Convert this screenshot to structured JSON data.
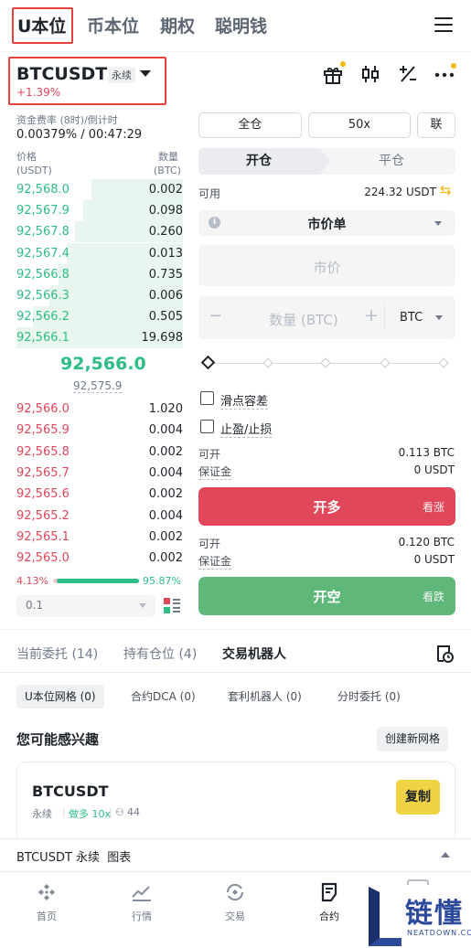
{
  "top_tabs": [
    "U本位",
    "币本位",
    "期权",
    "聪明钱"
  ],
  "symbol": "BTCUSDT",
  "perp_badge": "永续",
  "change": "+1.39%",
  "funding": {
    "label": "资金费率 (8时)/倒计时",
    "value": "0.00379% / 00:47:29"
  },
  "orderbook": {
    "price_label": "价格",
    "price_unit": "(USDT)",
    "qty_label": "数量",
    "qty_unit": "(BTC)",
    "asks": [
      {
        "p": "92,568.0",
        "q": "0.002",
        "depth": 0.55
      },
      {
        "p": "92,567.9",
        "q": "0.098",
        "depth": 0.6
      },
      {
        "p": "92,567.8",
        "q": "0.260",
        "depth": 0.65
      },
      {
        "p": "92,567.4",
        "q": "0.013",
        "depth": 0.7
      },
      {
        "p": "92,566.8",
        "q": "0.735",
        "depth": 0.75
      },
      {
        "p": "92,566.3",
        "q": "0.006",
        "depth": 0.8
      },
      {
        "p": "92,566.2",
        "q": "0.505",
        "depth": 0.9
      },
      {
        "p": "92,566.1",
        "q": "19.698",
        "depth": 1.0
      }
    ],
    "last_price": "92,566.0",
    "mark_price": "92,575.9",
    "bids": [
      {
        "p": "92,566.0",
        "q": "1.020"
      },
      {
        "p": "92,565.9",
        "q": "0.004"
      },
      {
        "p": "92,565.8",
        "q": "0.002"
      },
      {
        "p": "92,565.7",
        "q": "0.004"
      },
      {
        "p": "92,565.6",
        "q": "0.002"
      },
      {
        "p": "92,565.2",
        "q": "0.004"
      },
      {
        "p": "92,565.1",
        "q": "0.002"
      },
      {
        "p": "92,565.0",
        "q": "0.002"
      }
    ],
    "bid_ratio": "4.13%",
    "ask_ratio": "95.87%",
    "ask_ratio_value": 0.9587,
    "depth_step": "0.1"
  },
  "trade": {
    "margin_mode": "全仓",
    "leverage": "50x",
    "joint": "联",
    "open_tab": "开仓",
    "close_tab": "平仓",
    "avail_label": "可用",
    "avail_value": "224.32 USDT",
    "order_type": "市价单",
    "price_placeholder": "市价",
    "qty_placeholder": "数量 (BTC)",
    "qty_unit": "BTC",
    "slippage": "滑点容差",
    "tpsl": "止盈/止损",
    "long_open_label": "可开",
    "long_open_value": "0.113 BTC",
    "long_margin_label": "保证金",
    "long_margin_value": "0 USDT",
    "long_btn": "开多",
    "long_sub": "看涨",
    "short_open_label": "可开",
    "short_open_value": "0.120 BTC",
    "short_margin_label": "保证金",
    "short_margin_value": "0 USDT",
    "short_btn": "开空",
    "short_sub": "看跌"
  },
  "section_tabs": [
    "当前委托 (14)",
    "持有仓位 (4)",
    "交易机器人"
  ],
  "chips": [
    "U本位网格 (0)",
    "合约DCA (0)",
    "套利机器人 (0)",
    "分时委托 (0)"
  ],
  "interest": {
    "title": "您可能感兴趣",
    "create": "创建新网格"
  },
  "card": {
    "symbol": "BTCUSDT",
    "tag1": "永续",
    "tag2": "做多 10x",
    "users": "44",
    "copy": "复制"
  },
  "bottom_bar": "BTCUSDT 永续  图表",
  "nav": [
    "首页",
    "行情",
    "交易",
    "合约"
  ],
  "watermark": {
    "text": "链懂",
    "sub": "NEATDOWN.COM"
  },
  "colors": {
    "green": "#2ebd85",
    "red": "#e0475a",
    "accent": "#f0b90b",
    "highlight": "#e5413f"
  }
}
